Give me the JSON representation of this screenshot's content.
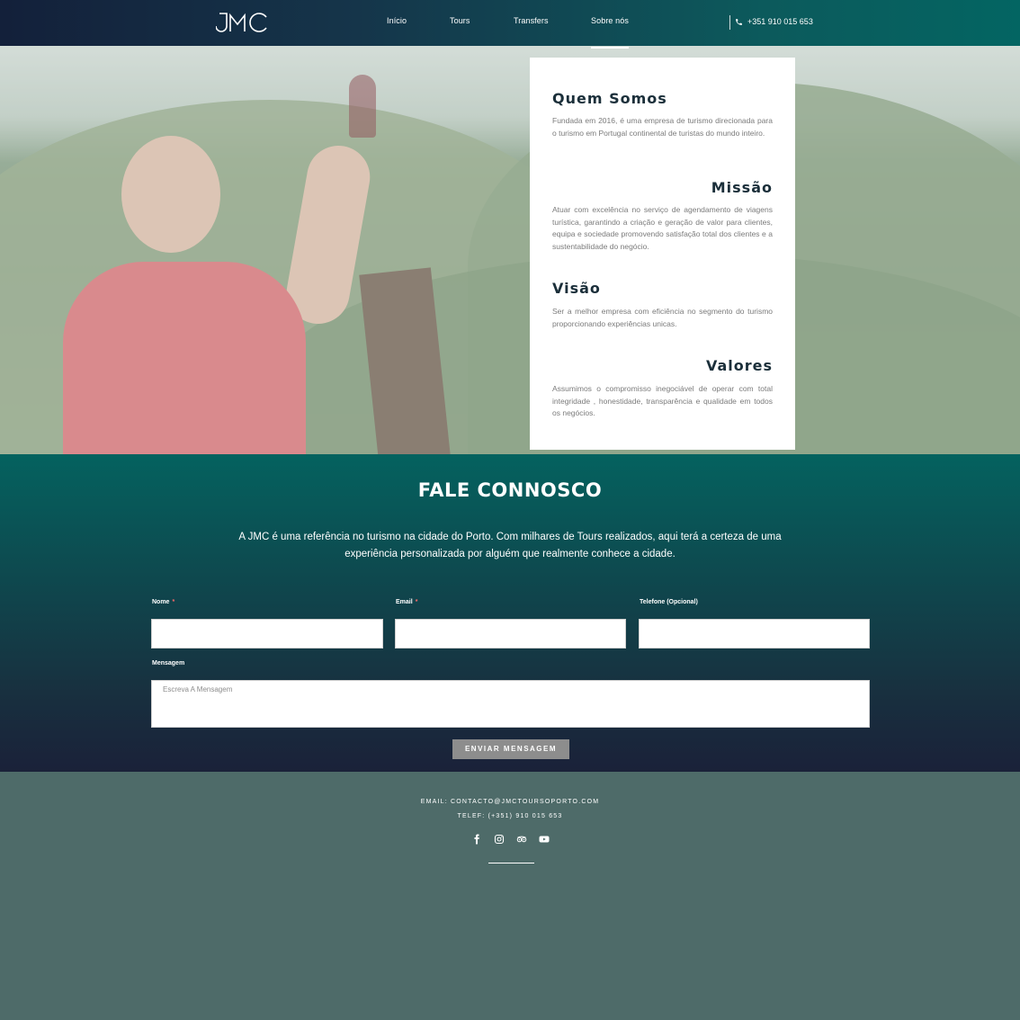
{
  "nav": {
    "logo_text": "JMC",
    "links": [
      "Início",
      "Tours",
      "Transfers",
      "Sobre nós"
    ],
    "active": "Sobre nós",
    "phone": "+351 910 015 653"
  },
  "about": {
    "quem_somos_title": "Quem Somos",
    "quem_somos_text": "Fundada em 2016, é uma empresa de turismo direcionada para o turismo em Portugal continental de turistas do mundo inteiro.",
    "missao_title": "Missão",
    "missao_text": "Atuar com excelência no serviço de agendamento de viagens turística, garantindo a criação e geração de valor para clientes, equipa e sociedade promovendo satisfação total dos clientes e a sustentabilidade do negócio.",
    "visao_title": "Visão",
    "visao_text": "Ser a melhor empresa com eficiência no segmento do turismo proporcionando experiências unicas.",
    "valores_title": "Valores",
    "valores_text": "Assumimos o compromisso inegociável de operar com total integridade , honestidade, transparência e qualidade em todos os negócios."
  },
  "contact": {
    "title": "FALE CONNOSCO",
    "description": "A JMC é uma referência no turismo na cidade do Porto. Com milhares de Tours realizados, aqui terá a certeza de uma experiência personalizada por alguém que realmente conhece a cidade.",
    "name_label": "Nome",
    "email_label": "Email",
    "phone_label": "Telefone (Opcional)",
    "required_mark": "*",
    "message_label": "Mensagem",
    "message_placeholder": "Escreva A Mensagem",
    "send_label": "ENVIAR MENSAGEM"
  },
  "footer": {
    "email_line": "EMAIL: CONTACTO@JMCTOURSOPORTO.COM",
    "phone_line": "TELEF: (+351) 910 015 653",
    "socials": [
      "facebook-icon",
      "instagram-icon",
      "tripadvisor-icon",
      "youtube-icon"
    ]
  }
}
